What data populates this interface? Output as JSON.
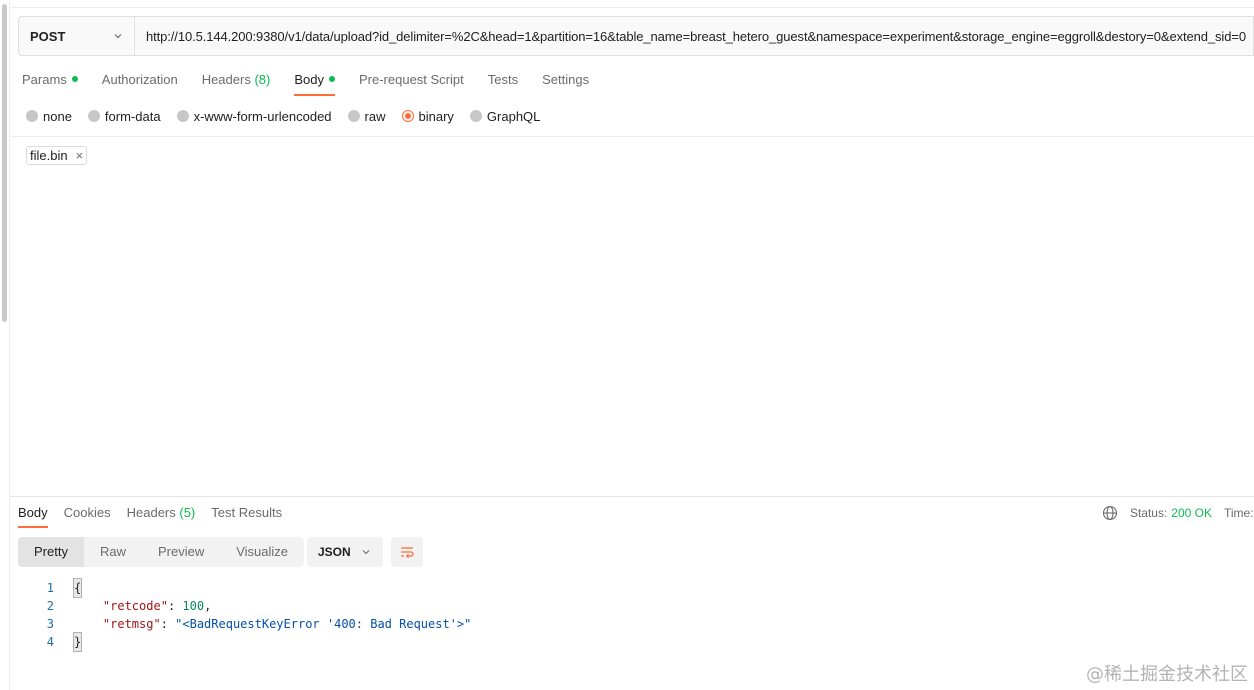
{
  "request": {
    "method": "POST",
    "url": "http://10.5.144.200:9380/v1/data/upload?id_delimiter=%2C&head=1&partition=16&table_name=breast_hetero_guest&namespace=experiment&storage_engine=eggroll&destory=0&extend_sid=0"
  },
  "request_tabs": [
    {
      "label": "Params",
      "dot": true
    },
    {
      "label": "Authorization"
    },
    {
      "label": "Headers",
      "count": "(8)"
    },
    {
      "label": "Body",
      "dot": true,
      "active": true
    },
    {
      "label": "Pre-request Script"
    },
    {
      "label": "Tests"
    },
    {
      "label": "Settings"
    }
  ],
  "body_types": [
    {
      "label": "none"
    },
    {
      "label": "form-data"
    },
    {
      "label": "x-www-form-urlencoded"
    },
    {
      "label": "raw"
    },
    {
      "label": "binary",
      "selected": true
    },
    {
      "label": "GraphQL"
    }
  ],
  "file": {
    "name": "file.bin",
    "remove_glyph": "×"
  },
  "response_tabs": [
    {
      "label": "Body",
      "active": true
    },
    {
      "label": "Cookies"
    },
    {
      "label": "Headers",
      "count": "(5)"
    },
    {
      "label": "Test Results"
    }
  ],
  "status": {
    "label": "Status:",
    "value": "200 OK",
    "time_label": "Time:"
  },
  "view_modes": [
    "Pretty",
    "Raw",
    "Preview",
    "Visualize"
  ],
  "format": "JSON",
  "code": {
    "line_numbers": [
      "1",
      "2",
      "3",
      "4"
    ],
    "open_brace": "{",
    "close_brace": "}",
    "retcode_key": "\"retcode\"",
    "retcode_value": "100",
    "retmsg_key": "\"retmsg\"",
    "retmsg_value": "\"<BadRequestKeyError '400: Bad Request'>\""
  },
  "watermark": "@稀土掘金技术社区",
  "colors": {
    "accent": "#ff6c37",
    "success": "#0cbb52"
  }
}
